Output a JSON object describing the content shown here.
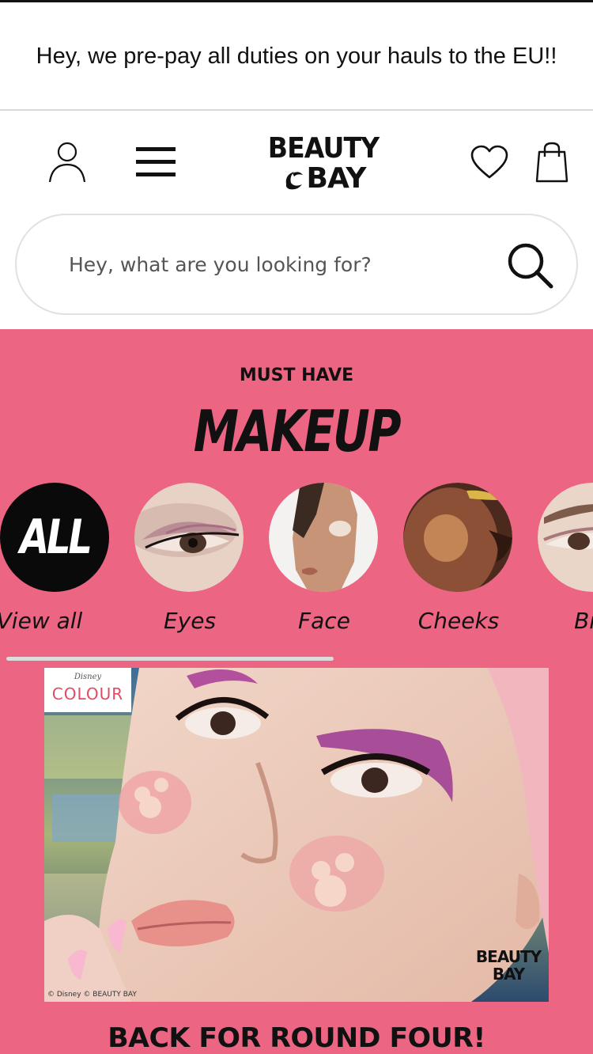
{
  "banner": {
    "text": "Hey, we pre-pay all duties on your hauls to the EU!!"
  },
  "header": {
    "logo_line1": "BEAUTY",
    "logo_line2": "BAY",
    "icons": [
      "user-icon",
      "menu-icon",
      "heart-icon",
      "bag-icon"
    ]
  },
  "search": {
    "placeholder": "Hey, what are you looking for?",
    "icon": "search-icon"
  },
  "promo": {
    "background": "#ec6583",
    "eyebrow": "MUST HAVE",
    "headline": "MAKEUP",
    "categories": [
      {
        "label": "View all",
        "badge": "ALL"
      },
      {
        "label": "Eyes"
      },
      {
        "label": "Face"
      },
      {
        "label": "Cheeks"
      },
      {
        "label": "Bro"
      }
    ],
    "hero": {
      "brand_small": "Disney",
      "brand": "COLOUR",
      "credit": "© Disney  © BEAUTY BAY",
      "logo_line1": "BEAUTY",
      "logo_line2": "BAY"
    },
    "bottom_headline": "BACK FOR ROUND FOUR!"
  }
}
